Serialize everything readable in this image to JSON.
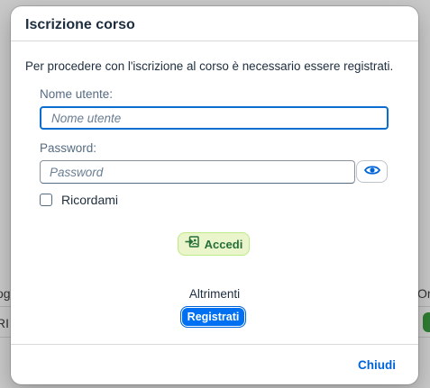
{
  "background": {
    "left_fragment": "og",
    "left_fragment_row2": "RI",
    "right_fragment": "Or"
  },
  "dialog": {
    "title": "Iscrizione corso",
    "intro": "Per procedere con l'iscrizione al corso è necessario essere registrati.",
    "username": {
      "label": "Nome utente:",
      "placeholder": "Nome utente",
      "value": ""
    },
    "password": {
      "label": "Password:",
      "placeholder": "Password",
      "value": "",
      "reveal_icon": "eye-icon"
    },
    "remember": {
      "label": "Ricordami",
      "checked": false
    },
    "login_button": {
      "label": "Accedi",
      "icon": "login-icon"
    },
    "alternative_text": "Altrimenti",
    "register_button": {
      "label": "Registrati"
    },
    "close_button": {
      "label": "Chiudi"
    }
  },
  "colors": {
    "accent": "#0070f2",
    "focus_border": "#0a6ed1",
    "login_bg": "#ebf5cb",
    "login_text": "#256f3a",
    "link": "#0064d9"
  }
}
